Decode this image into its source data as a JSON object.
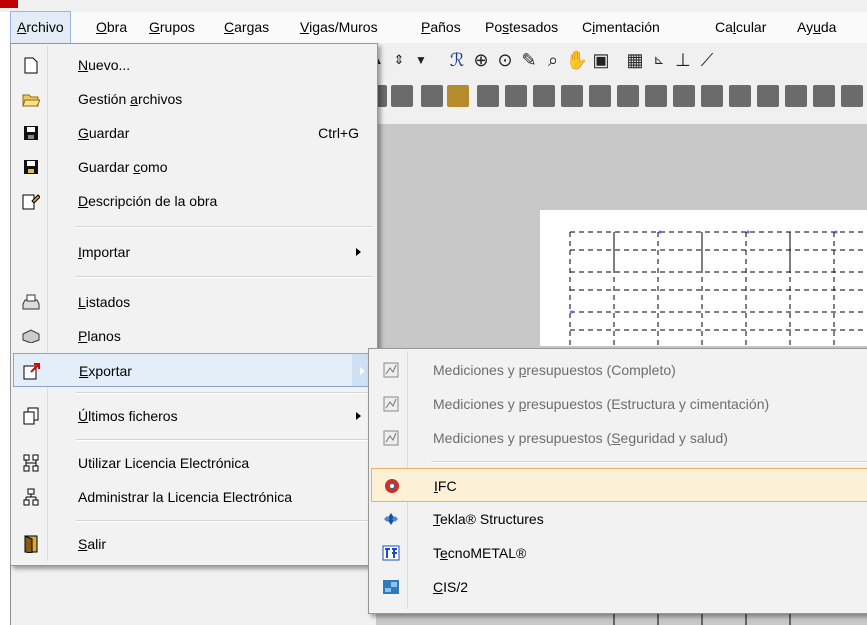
{
  "menubar": {
    "items": [
      {
        "pre": "",
        "u": "A",
        "post": "rchivo"
      },
      {
        "pre": "",
        "u": "O",
        "post": "bra"
      },
      {
        "pre": "",
        "u": "G",
        "post": "rupos"
      },
      {
        "pre": "",
        "u": "C",
        "post": "argas"
      },
      {
        "pre": "",
        "u": "V",
        "post": "igas/Muros"
      },
      {
        "pre": "",
        "u": "P",
        "post": "años"
      },
      {
        "pre": "Po",
        "u": "s",
        "post": "tesados"
      },
      {
        "pre": "C",
        "u": "i",
        "post": "mentación"
      },
      {
        "pre": "Ca",
        "u": "l",
        "post": "cular"
      },
      {
        "pre": "Ay",
        "u": "u",
        "post": "da"
      }
    ]
  },
  "file_menu": {
    "items": [
      {
        "pre": "",
        "u": "N",
        "post": "uevo...",
        "shortcut": "",
        "icon": "new-file-icon"
      },
      {
        "pre": "Gestión ",
        "u": "a",
        "post": "rchivos",
        "shortcut": "",
        "icon": "open-folder-icon"
      },
      {
        "pre": "",
        "u": "G",
        "post": "uardar",
        "shortcut": "Ctrl+G",
        "icon": "save-icon"
      },
      {
        "pre": "Guardar ",
        "u": "c",
        "post": "omo",
        "shortcut": "",
        "icon": "save-as-icon"
      },
      {
        "pre": "",
        "u": "D",
        "post": "escripción de la obra",
        "shortcut": "",
        "icon": "edit-document-icon"
      },
      {
        "pre": "",
        "u": "I",
        "post": "mportar",
        "shortcut": "",
        "icon": ""
      },
      {
        "pre": "",
        "u": "L",
        "post": "istados",
        "shortcut": "",
        "icon": "printer-icon"
      },
      {
        "pre": "",
        "u": "P",
        "post": "lanos",
        "shortcut": "",
        "icon": "plotter-icon"
      },
      {
        "pre": "",
        "u": "E",
        "post": "xportar",
        "shortcut": "",
        "icon": "export-icon"
      },
      {
        "pre": "",
        "u": "Ú",
        "post": "ltimos ficheros",
        "shortcut": "",
        "icon": "recent-files-icon"
      },
      {
        "pre": "Utilizar Licencia Electrónica",
        "u": "",
        "post": "",
        "shortcut": "",
        "icon": "license-network-icon"
      },
      {
        "pre": "Administrar la Licencia Electrónica",
        "u": "",
        "post": "",
        "shortcut": "",
        "icon": "license-admin-icon"
      },
      {
        "pre": "",
        "u": "S",
        "post": "alir",
        "shortcut": "",
        "icon": "exit-door-icon"
      }
    ]
  },
  "export_submenu": {
    "items": [
      {
        "pre": "Mediciones y ",
        "u": "p",
        "post": "resupuestos (Completo)",
        "disabled": true,
        "icon": "budget-icon"
      },
      {
        "pre": "Mediciones y ",
        "u": "p",
        "post": "resupuestos (Estructura y cimentación)",
        "disabled": true,
        "icon": "budget-icon"
      },
      {
        "pre": "Mediciones y presupuestos (",
        "u": "S",
        "post": "eguridad y salud)",
        "disabled": true,
        "icon": "budget-icon"
      },
      {
        "pre": "",
        "u": "I",
        "post": "FC",
        "disabled": false,
        "icon": "ifc-icon"
      },
      {
        "pre": "",
        "u": "T",
        "post": "ekla® Structures",
        "disabled": false,
        "icon": "tekla-icon"
      },
      {
        "pre": "T",
        "u": "e",
        "post": "cnoMETAL®",
        "disabled": false,
        "icon": "tecnometal-icon"
      },
      {
        "pre": "",
        "u": "C",
        "post": "IS/2",
        "disabled": false,
        "icon": "cis2-icon"
      }
    ]
  },
  "colors": {
    "menu_bg": "#f2f2f2",
    "highlight_blue": "#e4eef9",
    "highlight_orange": "#fcf1d6",
    "disabled_text": "#6d6d6d"
  }
}
